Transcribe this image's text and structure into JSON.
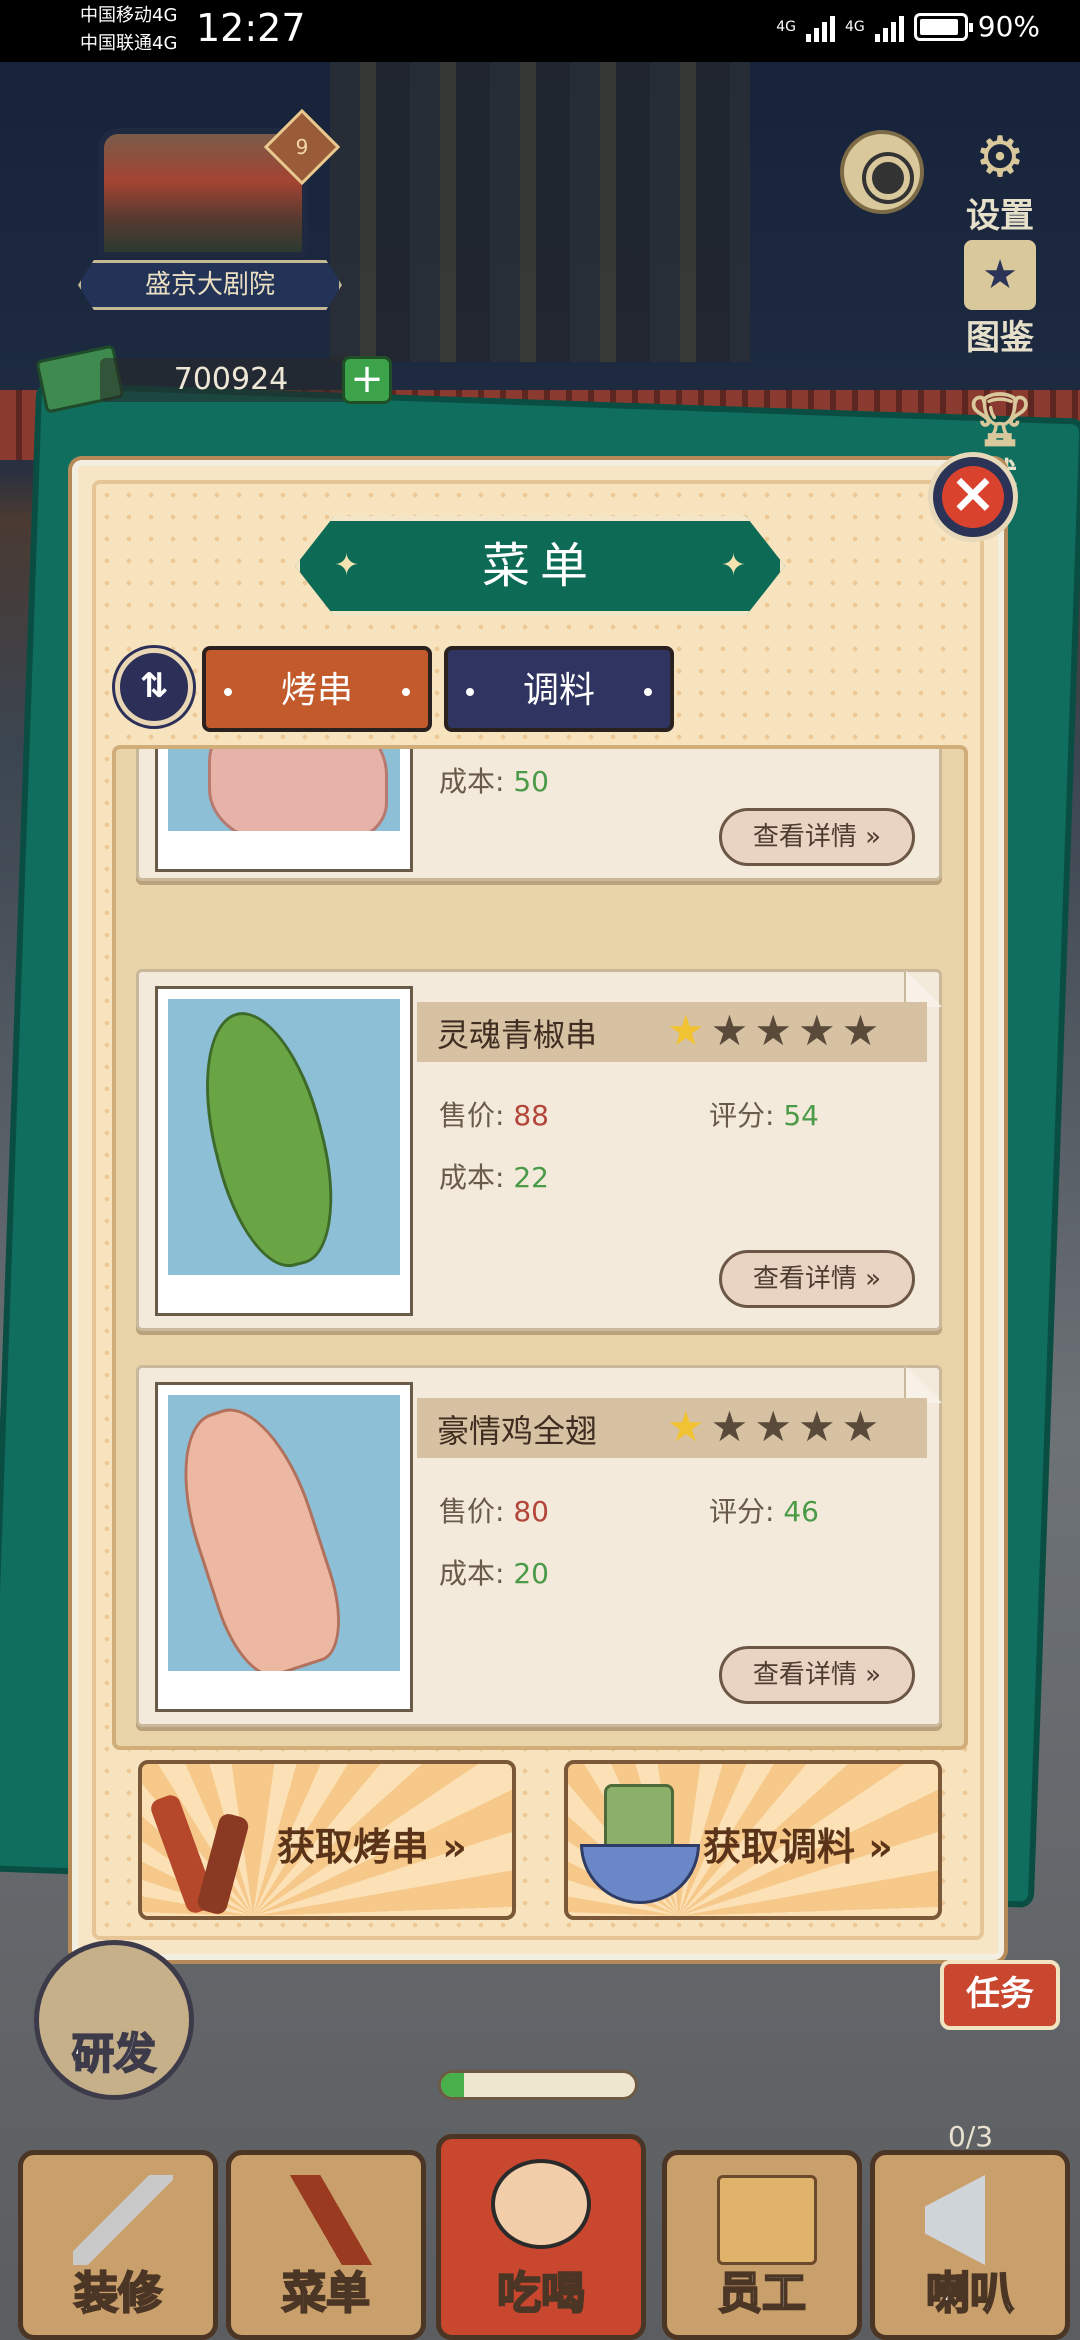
{
  "status_bar": {
    "carrier1": "中国移动4G",
    "carrier2": "中国联通4G",
    "time": "12:27",
    "signal1": "4G",
    "signal2": "4G",
    "battery": "90%"
  },
  "location": {
    "level": "9",
    "name": "盛京大剧院"
  },
  "money": {
    "amount": "700924"
  },
  "side": {
    "settings": "设置",
    "collection": "图鉴",
    "achievement": "就"
  },
  "menu": {
    "title": "菜单",
    "tabs": [
      {
        "label": "烤串"
      },
      {
        "label": "调料"
      }
    ],
    "sort_icon": "⇅",
    "items": [
      {
        "name": "",
        "stars": 0,
        "price_label": "",
        "price": "",
        "score_label": "",
        "score": "",
        "cost_label": "成本:",
        "cost": "50",
        "detail": "查看详情"
      },
      {
        "name": "灵魂青椒串",
        "stars": 1,
        "price_label": "售价:",
        "price": "88",
        "score_label": "评分:",
        "score": "54",
        "cost_label": "成本:",
        "cost": "22",
        "detail": "查看详情"
      },
      {
        "name": "豪情鸡全翅",
        "stars": 1,
        "price_label": "售价:",
        "price": "80",
        "score_label": "评分:",
        "score": "46",
        "cost_label": "成本:",
        "cost": "20",
        "detail": "查看详情"
      }
    ],
    "get_skewers": "获取烤串",
    "get_seasoning": "获取调料"
  },
  "bottom_nav": {
    "research": "研发",
    "decorate": "装修",
    "menu": "菜单",
    "eat_drink": "吃喝",
    "staff": "员工",
    "horn": "喇叭",
    "horn_count": "0/3",
    "task": "任务"
  },
  "progress": {
    "value": 0.12
  },
  "colors": {
    "accent_green": "#0d6a55",
    "tab_orange": "#c35a2c",
    "tab_navy": "#2f3460",
    "close_red": "#d9432e"
  }
}
